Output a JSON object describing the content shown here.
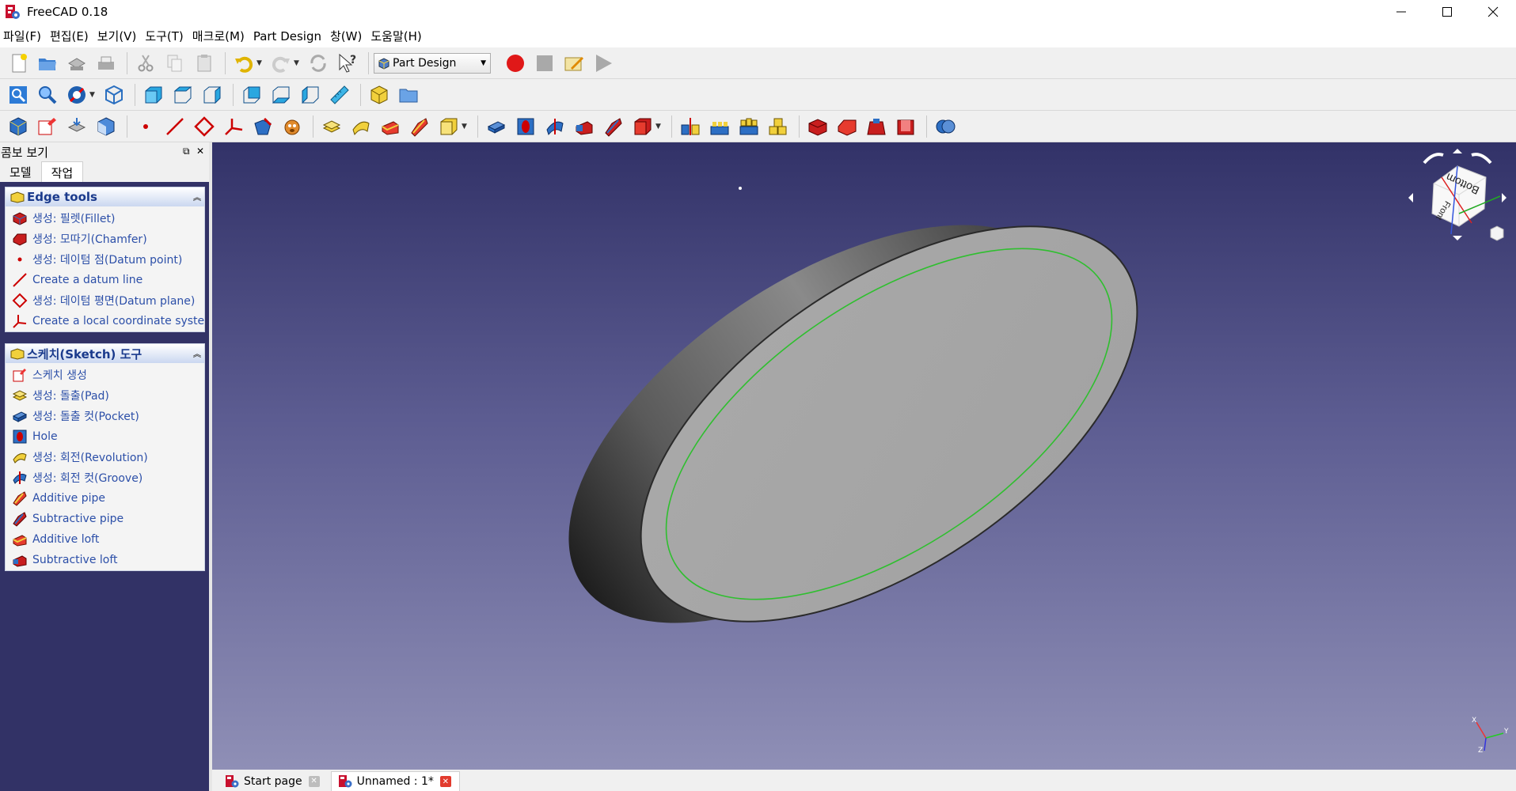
{
  "window": {
    "title": "FreeCAD 0.18"
  },
  "menu": [
    "파일(F)",
    "편집(E)",
    "보기(V)",
    "도구(T)",
    "매크로(M)",
    "Part Design",
    "창(W)",
    "도움말(H)"
  ],
  "workbench": {
    "selected": "Part Design"
  },
  "combo": {
    "title": "콤보 보기",
    "tabs": [
      "모델",
      "작업"
    ],
    "active_tab": "작업"
  },
  "edge_tools": {
    "title": "Edge tools",
    "items": [
      "생성: 필렛(Fillet)",
      "생성: 모따기(Chamfer)",
      "생성: 데이텀 점(Datum point)",
      "Create a datum line",
      "생성: 데이텀 평면(Datum plane)",
      "Create a local coordinate system"
    ]
  },
  "sketch_tools": {
    "title": "스케치(Sketch) 도구",
    "items": [
      "스케치 생성",
      "생성: 돌출(Pad)",
      "생성: 돌출 컷(Pocket)",
      "Hole",
      "생성: 회전(Revolution)",
      "생성: 회전 컷(Groove)",
      "Additive pipe",
      "Subtractive pipe",
      "Additive loft",
      "Subtractive loft"
    ]
  },
  "navcube": {
    "faces": [
      "Bottom",
      "Front"
    ]
  },
  "axes": {
    "x": "X",
    "y": "Y",
    "z": "Z"
  },
  "doc_tabs": [
    {
      "label": "Start page",
      "active": false
    },
    {
      "label": "Unnamed : 1*",
      "active": true
    }
  ],
  "colors": {
    "viewport_top": "#323268",
    "viewport_bottom": "#8f8fb6",
    "selection_green": "#2fbf2f",
    "panel_bg": "#323266"
  }
}
